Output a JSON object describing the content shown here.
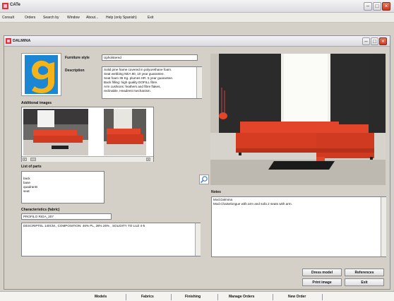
{
  "app": {
    "title": "CATe"
  },
  "menu": [
    "Consult",
    "Orders",
    "Search by",
    "Window",
    "About...",
    "Help (only Spanish)",
    "Exit"
  ],
  "window": {
    "title": "DALMINA"
  },
  "product": {
    "furniture_style_label": "Furniture style",
    "furniture_style_value": "Upholstered",
    "description_label": "Description",
    "description_lines": [
      "Solid pine frame covered in polyurethane foam.",
      "Seat webbing NEA 80, 10 year guarantee.",
      "Seat foam 35 Kg. plumes HR. 5 year guarantee.",
      "Back filling: high quality DOFILL fibre.",
      "Arm cushions: feathers and fibre flakes,",
      "reclinable. Headrest mechanism."
    ]
  },
  "additional_images_label": "Additional images",
  "parts": {
    "label": "List of parts",
    "items": [
      "back",
      "base",
      "quadrants",
      "seat"
    ]
  },
  "characteristics": {
    "label": "Characteristics (fabric)",
    "value": "PROFILO RIGA_207",
    "detail": "DESCRIPTEL 140CM., COMPOSITION: 46% PL, 28% 26% , SOLIDITY TO LUZ 4-5"
  },
  "notes": {
    "label": "Notes",
    "lines": [
      "Mod.Dalmina",
      "Mod.Chaiselongue with arm and sofa 2 seats with arm."
    ]
  },
  "buttons": {
    "dress_model": "Dress model",
    "references": "References",
    "print_image": "Print image",
    "exit": "Exit"
  },
  "bottom_tabs": [
    "Models",
    "Fabrics",
    "Finishing",
    "Manage Orders",
    "New Order"
  ],
  "colors": {
    "sofa": "#e2452a",
    "logo_bg": "#1a86d4",
    "logo_fg": "#f5b317",
    "accent": "#c83a22"
  },
  "icons": {
    "zoom": "magnifier-icon",
    "logo": "brand-logo-g"
  }
}
